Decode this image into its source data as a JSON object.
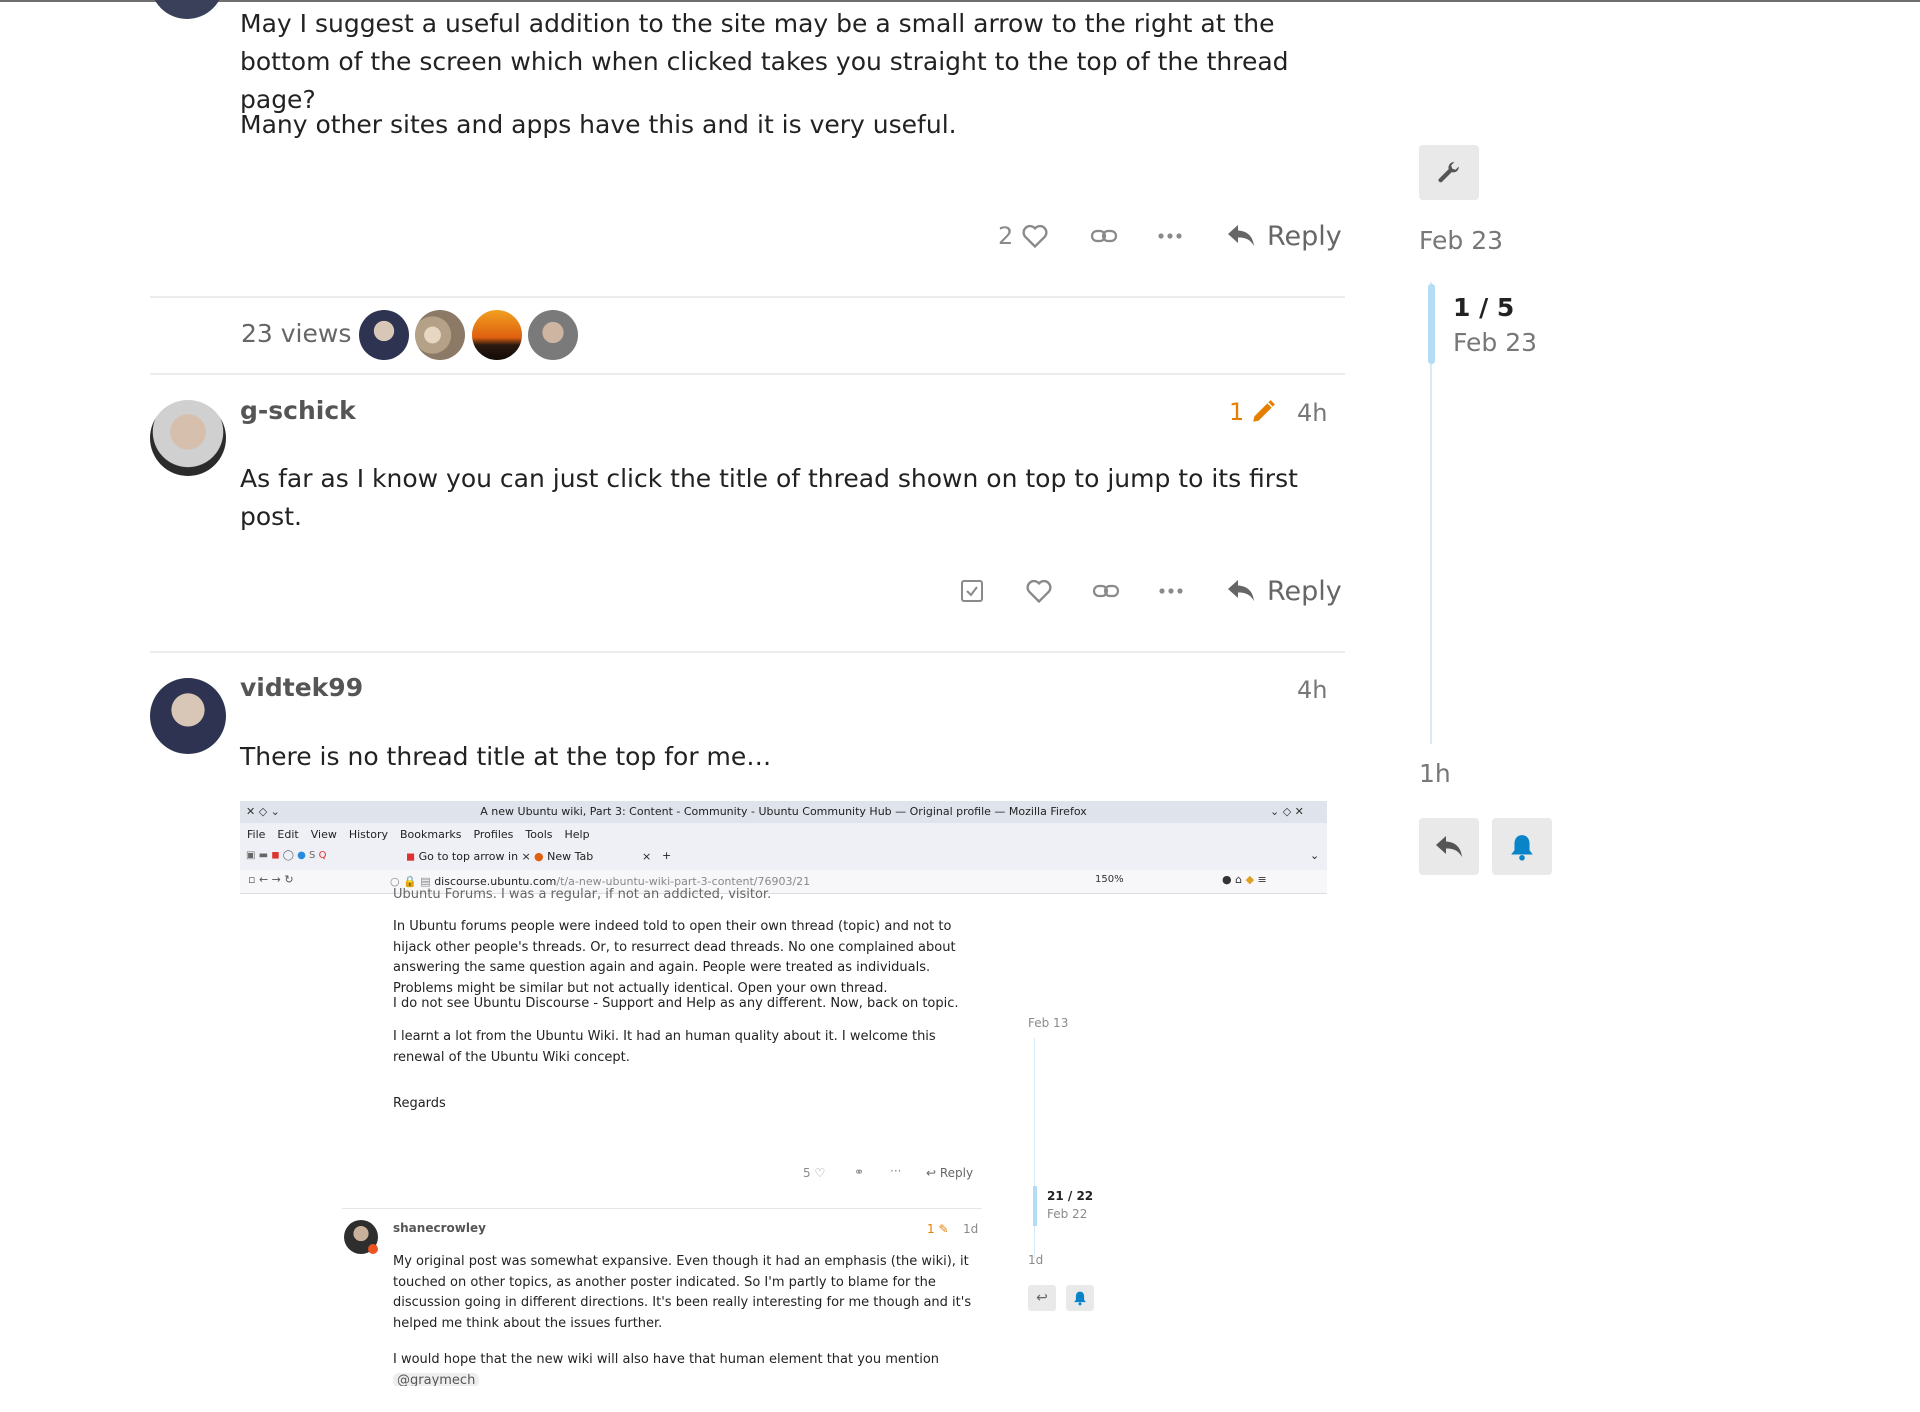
{
  "post1": {
    "paragraph1": "May I suggest a useful addition to the site may be a small arrow to the right at the bottom of the screen which when clicked takes you straight to the top of the thread page?",
    "paragraph2": "Many other sites and apps have this and it is very useful.",
    "like_count": "2",
    "reply_label": "Reply"
  },
  "topic_meta": {
    "views": "23 views"
  },
  "post2": {
    "username": "g-schick",
    "edit_count": "1",
    "time": "4h",
    "text": "As far as I know you can just click the title of thread shown on top to jump to its first post.",
    "reply_label": "Reply"
  },
  "post3": {
    "username": "vidtek99",
    "time": "4h",
    "text": "There is no thread title at the top for me…"
  },
  "timeline": {
    "top_date": "Feb 23",
    "position": "1 / 5",
    "position_date": "Feb 23",
    "bottom_date": "1h"
  },
  "embedded_screenshot": {
    "window_title": "A new Ubuntu wiki, Part 3: Content - Community - Ubuntu Community Hub — Original profile — Mozilla Firefox",
    "menu": [
      "File",
      "Edit",
      "View",
      "History",
      "Bookmarks",
      "Profiles",
      "Tools",
      "Help"
    ],
    "tab1": "Go to top arrow in",
    "tab2": "New Tab",
    "url_domain": "discourse.ubuntu.com",
    "url_path": "/t/a-new-ubuntu-wiki-part-3-content/76903/21",
    "zoom": "150%",
    "cut_line": "Ubuntu Forums. I was a regular, if not an addicted, visitor.",
    "para1": "In Ubuntu forums people were indeed told to open their own thread (topic) and not to hijack other people's threads. Or, to resurrect dead threads. No one complained about answering the same question again and again. People were treated as individuals. Problems might be similar but not actually identical. Open your own thread.",
    "para2": "I do not see Ubuntu Discourse - Support and Help as any different. Now, back on topic.",
    "para3": "I learnt a lot from the Ubuntu Wiki. It had an human quality about it. I welcome this renewal of the Ubuntu Wiki concept.",
    "para4": "Regards",
    "like_count": "5",
    "reply_label": "Reply",
    "tl_date_top": "Feb 13",
    "tl_position": "21 / 22",
    "tl_position_date": "Feb 22",
    "tl_date_bottom": "1d",
    "reply_username": "shanecrowley",
    "reply_edit_count": "1",
    "reply_time": "1d",
    "reply_para1": "My original post was somewhat expansive. Even though it had an emphasis (the wiki), it touched on other topics, as another poster indicated. So I'm partly to blame for the discussion going in different directions. It's been really interesting for me though and it's helped me think about the issues further.",
    "reply_para2_prefix": "I would hope that the new wiki will also have that human element that you mention",
    "reply_mention": "@graymech",
    "reply_para2_suffix": "."
  },
  "colors": {
    "accent_edit": "#e57f00",
    "notification_bell": "#0a84c9",
    "timeline_track": "#b4ddf3"
  }
}
